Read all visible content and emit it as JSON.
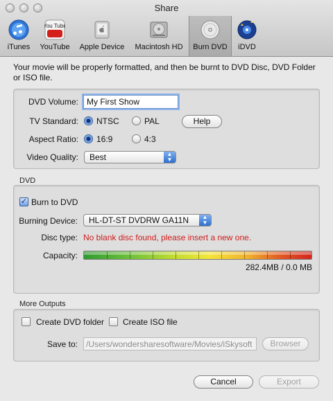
{
  "window": {
    "title": "Share"
  },
  "toolbar": {
    "items": [
      {
        "label": "iTunes",
        "icon": "itunes-icon"
      },
      {
        "label": "YouTube",
        "icon": "youtube-icon",
        "icon_text": "You Tube"
      },
      {
        "label": "Apple Device",
        "icon": "apple-device-icon"
      },
      {
        "label": "Macintosh HD",
        "icon": "hard-drive-icon"
      },
      {
        "label": "Burn DVD",
        "icon": "dvd-disc-icon",
        "selected": true
      },
      {
        "label": "iDVD",
        "icon": "idvd-icon"
      }
    ]
  },
  "intro_text": "Your movie will be properly formatted, and then be burnt to DVD Disc, DVD Folder or ISO file.",
  "settings": {
    "dvd_volume_label": "DVD Volume:",
    "dvd_volume_value": "My First Show",
    "tv_standard_label": "TV Standard:",
    "tv_standard_options": [
      "NTSC",
      "PAL"
    ],
    "tv_standard_selected": "NTSC",
    "help_label": "Help",
    "aspect_ratio_label": "Aspect Ratio:",
    "aspect_ratio_options": [
      "16:9",
      "4:3"
    ],
    "aspect_ratio_selected": "16:9",
    "video_quality_label": "Video Quality:",
    "video_quality_value": "Best"
  },
  "dvd": {
    "section_title": "DVD",
    "burn_label": "Burn to DVD",
    "burn_checked": true,
    "device_label": "Burning Device:",
    "device_value": "HL-DT-ST DVDRW GA11N",
    "disc_type_label": "Disc type:",
    "disc_type_value": "No blank disc found, please insert a new one.",
    "capacity_label": "Capacity:",
    "capacity_text": "282.4MB / 0.0 MB"
  },
  "more_outputs": {
    "section_title": "More Outputs",
    "create_folder_label": "Create DVD folder",
    "create_iso_label": "Create ISO file",
    "save_to_label": "Save to:",
    "save_to_path": "/Users/wondersharesoftware/Movies/iSkysoft",
    "browse_label": "Browser"
  },
  "footer": {
    "cancel_label": "Cancel",
    "export_label": "Export"
  },
  "colors": {
    "accent": "#4f88d9",
    "error": "#d11a1a"
  }
}
